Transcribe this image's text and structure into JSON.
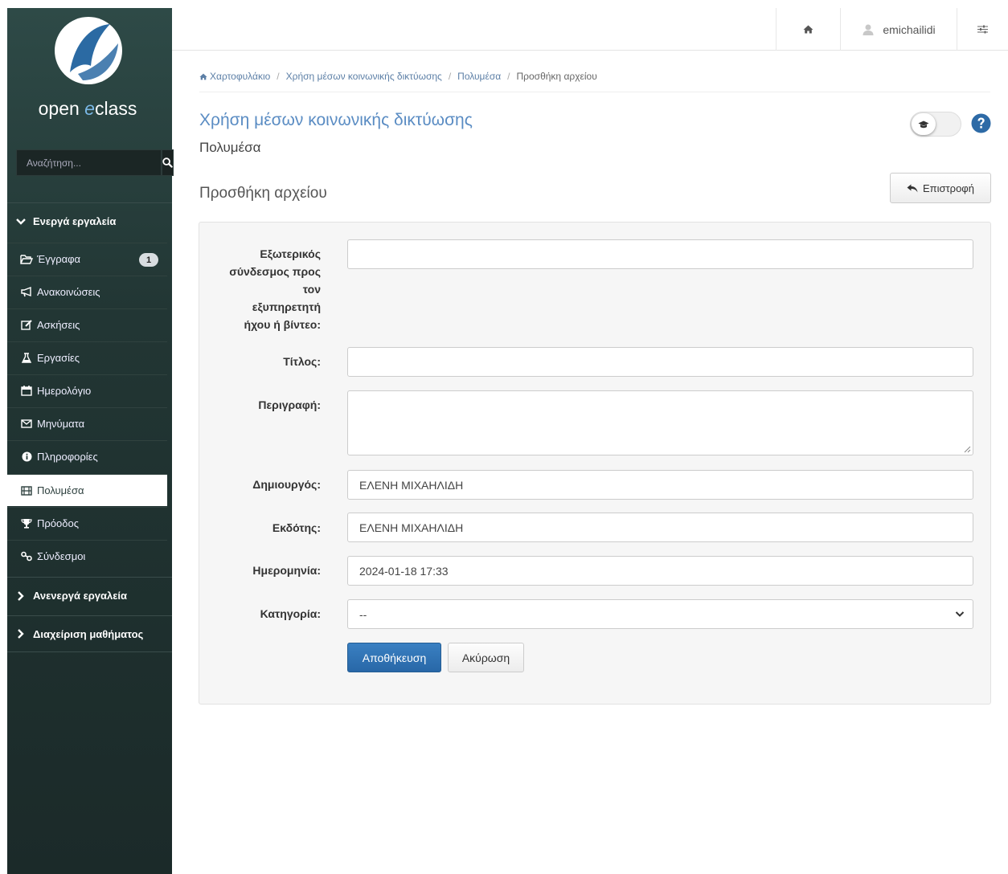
{
  "brand": {
    "logo_text_pre": "open ",
    "logo_text_e": "e",
    "logo_text_post": "class"
  },
  "search": {
    "placeholder": "Αναζήτηση..."
  },
  "sidebar": {
    "active_tools_label": "Ενεργά εργαλεία",
    "items": [
      {
        "label": "Έγγραφα",
        "icon": "folder-open-icon",
        "badge": "1"
      },
      {
        "label": "Ανακοινώσεις",
        "icon": "bullhorn-icon"
      },
      {
        "label": "Ασκήσεις",
        "icon": "edit-icon"
      },
      {
        "label": "Εργασίες",
        "icon": "flask-icon"
      },
      {
        "label": "Ημερολόγιο",
        "icon": "calendar-icon"
      },
      {
        "label": "Μηνύματα",
        "icon": "envelope-icon"
      },
      {
        "label": "Πληροφορίες",
        "icon": "info-circle-icon"
      },
      {
        "label": "Πολυμέσα",
        "icon": "film-icon",
        "active": true
      },
      {
        "label": "Πρόοδος",
        "icon": "trophy-icon"
      },
      {
        "label": "Σύνδεσμοι",
        "icon": "link-icon"
      }
    ],
    "inactive_tools_label": "Ανενεργά εργαλεία",
    "course_admin_label": "Διαχείριση μαθήματος"
  },
  "topbar": {
    "username": "emichailidi"
  },
  "breadcrumb": {
    "home": "Χαρτοφυλάκιο",
    "course": "Χρήση μέσων κοινωνικής δικτύωσης",
    "module": "Πολυμέσα",
    "current": "Προσθήκη αρχείου"
  },
  "course": {
    "title": "Χρήση μέσων κοινωνικής δικτύωσης",
    "module": "Πολυμέσα"
  },
  "page": {
    "heading": "Προσθήκη αρχείου",
    "back_label": "Επιστροφή"
  },
  "form": {
    "url_label_lines": [
      "Εξωτερικός",
      "σύνδεσμος προς",
      "τον",
      "εξυπηρετητή",
      "ήχου ή βίντεο:"
    ],
    "url_value": "",
    "title_label": "Τίτλος:",
    "title_value": "",
    "description_label": "Περιγραφή:",
    "description_value": "",
    "creator_label": "Δημιουργός:",
    "creator_value": "ΕΛΕΝΗ ΜΙΧΑΗΛΙΔΗ",
    "publisher_label": "Εκδότης:",
    "publisher_value": "ΕΛΕΝΗ ΜΙΧΑΗΛΙΔΗ",
    "date_label": "Ημερομηνία:",
    "date_value": "2024-01-18 17:33",
    "category_label": "Κατηγορία:",
    "category_value": "--",
    "save_label": "Αποθήκευση",
    "cancel_label": "Ακύρωση"
  },
  "colors": {
    "sidebar_bg": "#223634",
    "link": "#5c7fa6",
    "title": "#5a8cc3",
    "primary": "#2f73b5"
  }
}
